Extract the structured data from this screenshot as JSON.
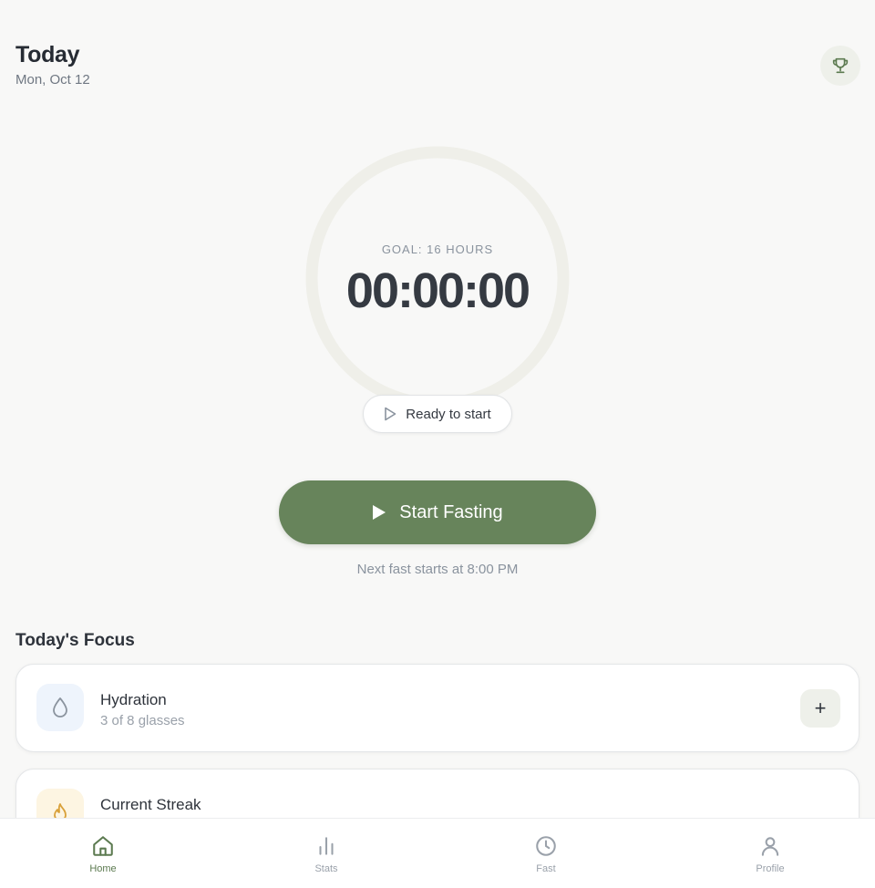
{
  "header": {
    "title": "Today",
    "date": "Mon, Oct 12"
  },
  "timer": {
    "goal_label": "GOAL: 16 HOURS",
    "elapsed": "00:00:00",
    "status": "Ready to start",
    "progress": 0
  },
  "actions": {
    "start_label": "Start Fasting",
    "next_fast": "Next fast starts at 8:00 PM"
  },
  "focus": {
    "section_title": "Today's Focus",
    "cards": [
      {
        "title": "Hydration",
        "subtitle": "3 of 8 glasses",
        "icon": "water-drop-icon",
        "action": "+"
      },
      {
        "title": "Current Streak",
        "subtitle": "",
        "icon": "flame-icon"
      }
    ]
  },
  "nav": {
    "items": [
      {
        "label": "Home",
        "icon": "home-icon",
        "active": true
      },
      {
        "label": "Stats",
        "icon": "bar-chart-icon",
        "active": false
      },
      {
        "label": "Fast",
        "icon": "clock-icon",
        "active": false
      },
      {
        "label": "Profile",
        "icon": "user-icon",
        "active": false
      }
    ]
  },
  "colors": {
    "accent": "#67845b",
    "background": "#f8f8f7",
    "ring_track": "#efefe9"
  }
}
